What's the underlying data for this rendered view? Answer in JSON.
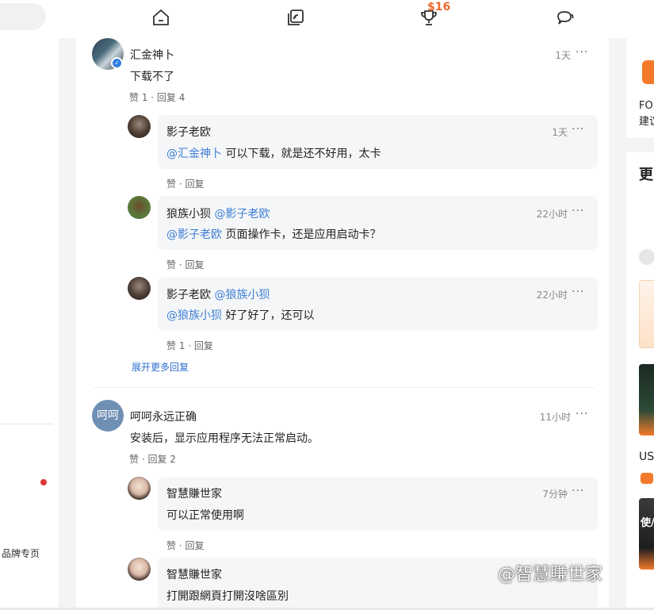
{
  "topbar": {
    "reward_badge": "$16",
    "icons": [
      "home-icon",
      "cast-icon",
      "trophy-icon",
      "chat-icon"
    ]
  },
  "left": {
    "brand_label": "品牌专页"
  },
  "comments": [
    {
      "user": "汇金神卜",
      "time": "1天",
      "text": "下载不了",
      "like_label": "赞 1",
      "reply_label": "回复 4",
      "replies": [
        {
          "user": "影子老欧",
          "to": "",
          "time": "1天",
          "mention": "@汇金神卜",
          "text": " 可以下载，就是还不好用，太卡",
          "like_label": "赞",
          "reply_label": "回复"
        },
        {
          "user": "狼族小狈",
          "to": "@影子老欧",
          "time": "22小时",
          "mention": "@影子老欧",
          "text": " 页面操作卡，还是应用启动卡？",
          "like_label": "赞",
          "reply_label": "回复"
        },
        {
          "user": "影子老欧",
          "to": "@狼族小狈",
          "time": "22小时",
          "mention": "@狼族小狈",
          "text": " 好了好了，还可以",
          "like_label": "赞 1",
          "reply_label": "回复"
        }
      ],
      "expand_label": "展开更多回复"
    },
    {
      "user": "呵呵永远正确",
      "avatar_text": "呵呵",
      "time": "11小时",
      "text": "安装后，显示应用程序无法正常启动。",
      "like_label": "赞",
      "reply_label": "回复 2",
      "replies": [
        {
          "user": "智慧賺世家",
          "to": "",
          "time": "7分钟",
          "mention": "",
          "text": "可以正常使用啊",
          "like_label": "赞",
          "reply_label": "回复"
        },
        {
          "user": "智慧賺世家",
          "to": "",
          "time": "",
          "mention": "",
          "text": "打開跟網頁打開沒啥區別",
          "like_label": "",
          "reply_label": ""
        }
      ]
    }
  ],
  "right": {
    "fo_text": "FOI",
    "jian_text": "建议",
    "geng_text": "更",
    "us_text": "US",
    "shi_text": "使/"
  },
  "watermark": "@智慧賺世家",
  "colors": {
    "accent": "#3c7dd6",
    "badge": "#f2682e",
    "orange": "#f47a2b"
  }
}
